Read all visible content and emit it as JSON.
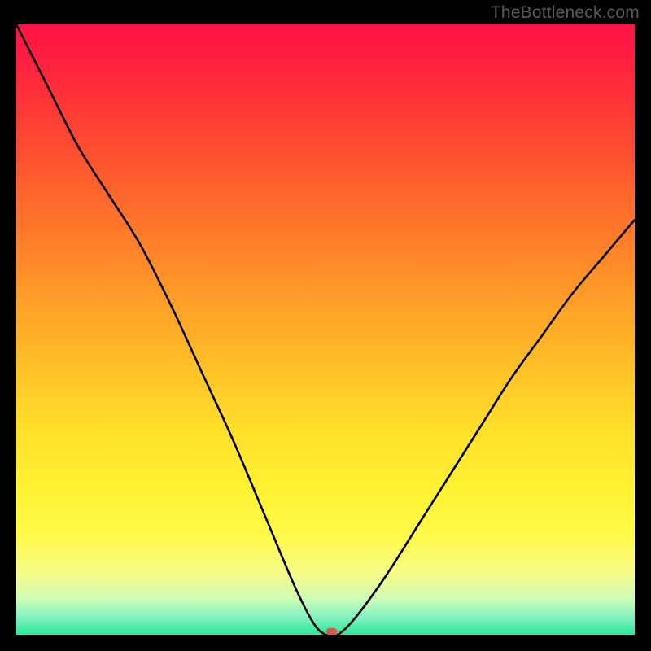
{
  "watermark": "TheBottleneck.com",
  "chart_data": {
    "type": "line",
    "title": "",
    "xlabel": "",
    "ylabel": "",
    "xlim": [
      0,
      100
    ],
    "ylim": [
      0,
      100
    ],
    "grid": false,
    "legend": false,
    "annotations": [],
    "x": [
      0,
      5,
      10,
      15,
      20,
      25,
      30,
      35,
      40,
      45,
      48,
      50,
      52,
      55,
      60,
      65,
      70,
      75,
      80,
      85,
      90,
      95,
      100
    ],
    "values": [
      100,
      90,
      80,
      72,
      64,
      54,
      43,
      32,
      20,
      8,
      2,
      0,
      0,
      3,
      10,
      18,
      26,
      34,
      42,
      49,
      56,
      62,
      68
    ],
    "marker": {
      "x": 51,
      "y": 0.5
    },
    "background_gradient": {
      "stops": [
        {
          "offset": 0.0,
          "color": "#ff1446"
        },
        {
          "offset": 0.06,
          "color": "#ff2040"
        },
        {
          "offset": 0.16,
          "color": "#ff4034"
        },
        {
          "offset": 0.26,
          "color": "#ff602c"
        },
        {
          "offset": 0.36,
          "color": "#ff802a"
        },
        {
          "offset": 0.46,
          "color": "#ffa028"
        },
        {
          "offset": 0.56,
          "color": "#ffc028"
        },
        {
          "offset": 0.66,
          "color": "#ffde2a"
        },
        {
          "offset": 0.76,
          "color": "#fff232"
        },
        {
          "offset": 0.84,
          "color": "#fffa4a"
        },
        {
          "offset": 0.9,
          "color": "#f6fd8a"
        },
        {
          "offset": 0.94,
          "color": "#d0fcb4"
        },
        {
          "offset": 0.97,
          "color": "#86f3c0"
        },
        {
          "offset": 1.0,
          "color": "#2de69e"
        }
      ]
    }
  }
}
